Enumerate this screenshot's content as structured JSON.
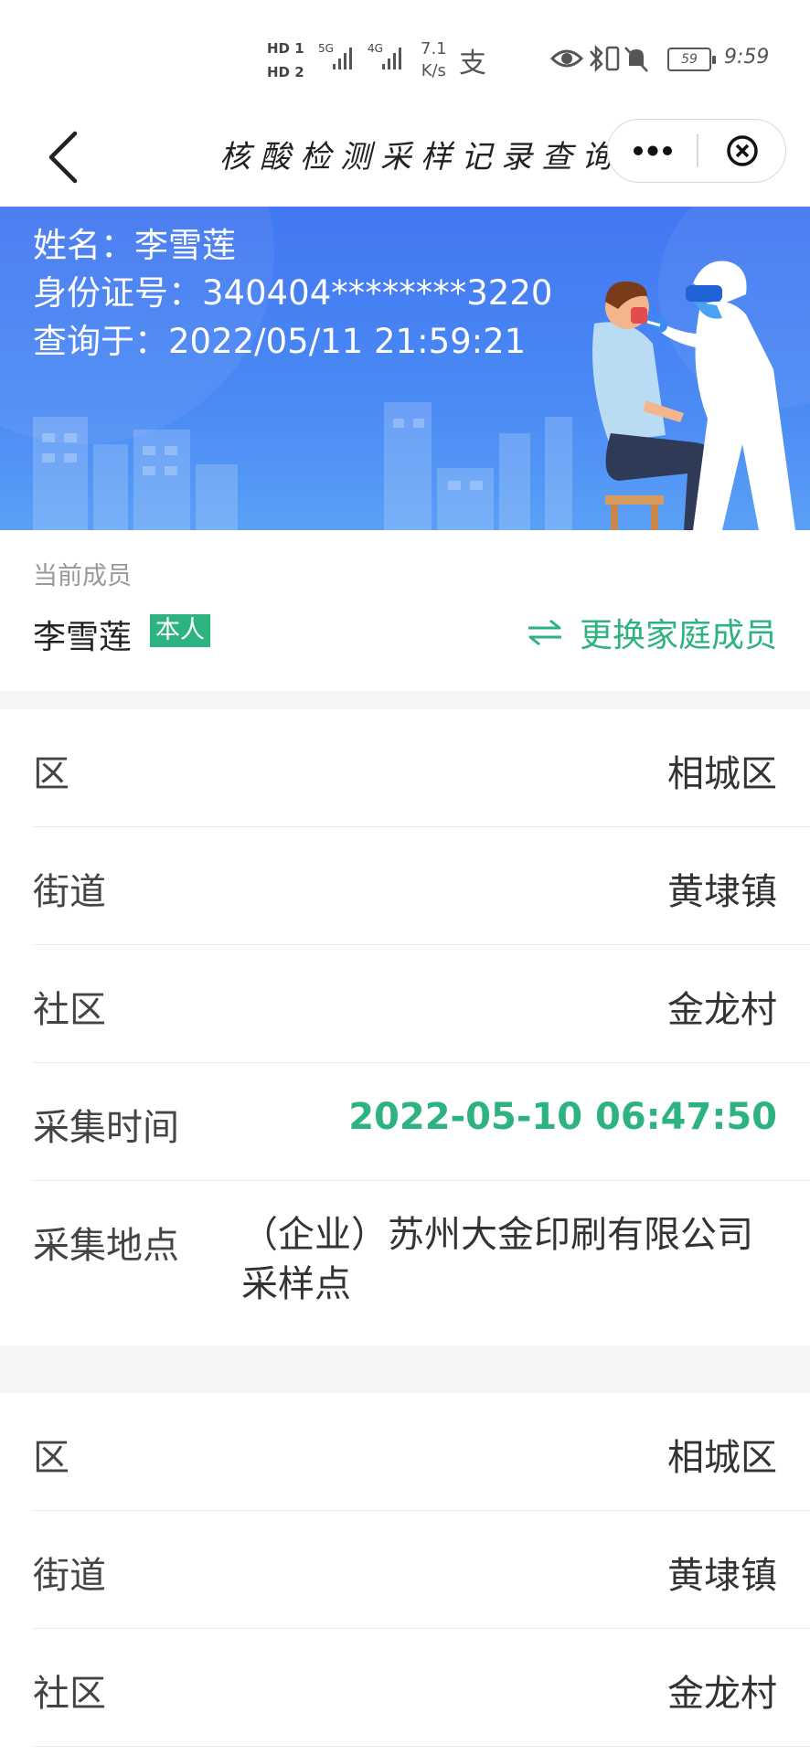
{
  "status_bar": {
    "hd1": "HD 1",
    "hd2": "HD 2",
    "net_5g": "5G",
    "net_4g": "4G",
    "speed_value": "7.1",
    "speed_unit": "K/s",
    "alipay_glyph": "支",
    "battery": "59",
    "time": "9:59",
    "icons": [
      "eye-icon",
      "bluetooth-icon",
      "vibrate-icon",
      "mute-bell-icon",
      "battery-icon"
    ]
  },
  "nav": {
    "title": "核酸检测采样记录查询",
    "icons": [
      "back-arrow-icon",
      "more-dots-icon",
      "close-circle-icon"
    ]
  },
  "banner": {
    "name_label": "姓名：",
    "name_value": "李雪莲",
    "id_label": "身份证号：",
    "id_value": "340404********3220",
    "query_label": "查询于：",
    "query_value": "2022/05/11 21:59:21",
    "bg_color": "#4277f2"
  },
  "member": {
    "caption": "当前成员",
    "name": "李雪莲",
    "badge": "本人",
    "switch_label": "更换家庭成员",
    "accent_color": "#2db37f"
  },
  "records": [
    {
      "rows": [
        {
          "label": "区",
          "value": "相城区"
        },
        {
          "label": "街道",
          "value": "黄埭镇"
        },
        {
          "label": "社区",
          "value": "金龙村"
        },
        {
          "label": "采集时间",
          "value": "2022-05-10 06:47:50"
        },
        {
          "label": "采集地点",
          "value": "（企业）苏州大金印刷有限公司采样点"
        }
      ]
    },
    {
      "rows": [
        {
          "label": "区",
          "value": "相城区"
        },
        {
          "label": "街道",
          "value": "黄埭镇"
        },
        {
          "label": "社区",
          "value": "金龙村"
        }
      ]
    }
  ]
}
